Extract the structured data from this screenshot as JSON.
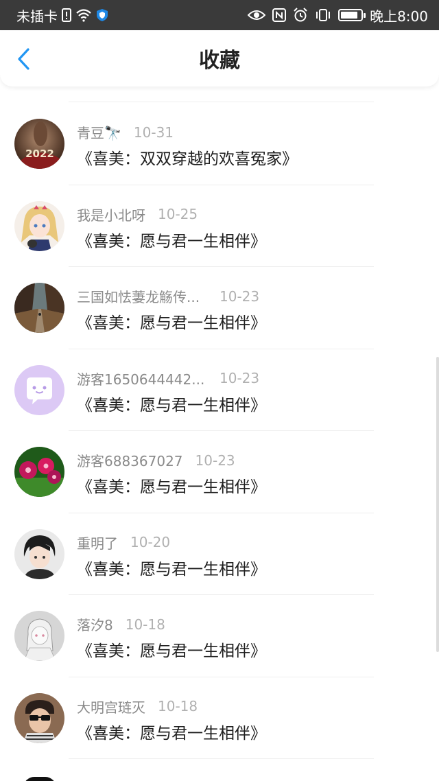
{
  "status_bar": {
    "carrier": "未插卡",
    "time": "晚上8:00",
    "battery_level": 0.85,
    "icons": [
      "sim-alert-icon",
      "wifi-icon",
      "shield-icon",
      "eye-icon",
      "nfc-icon",
      "alarm-icon",
      "vibrate-icon",
      "battery-icon"
    ]
  },
  "header": {
    "title": "收藏",
    "back_icon": "chevron-left-icon",
    "accent_color": "#2196F3"
  },
  "items": [
    {
      "name": "青豆🔭",
      "date": "10-31",
      "title": "《喜美：双双穿越的欢喜冤家》"
    },
    {
      "name": "我是小北呀",
      "date": "10-25",
      "title": "《喜美：愿与君一生相伴》"
    },
    {
      "name": "三国如怯萋龙觞传...",
      "date": "10-23",
      "title": "《喜美：愿与君一生相伴》"
    },
    {
      "name": "游客1650644442...",
      "date": "10-23",
      "title": "《喜美：愿与君一生相伴》"
    },
    {
      "name": "游客688367027",
      "date": "10-23",
      "title": "《喜美：愿与君一生相伴》"
    },
    {
      "name": "重明了",
      "date": "10-20",
      "title": "《喜美：愿与君一生相伴》"
    },
    {
      "name": "落汐8",
      "date": "10-18",
      "title": "《喜美：愿与君一生相伴》"
    },
    {
      "name": "大明宫琏灭",
      "date": "10-18",
      "title": "《喜美：愿与君一生相伴》"
    }
  ]
}
